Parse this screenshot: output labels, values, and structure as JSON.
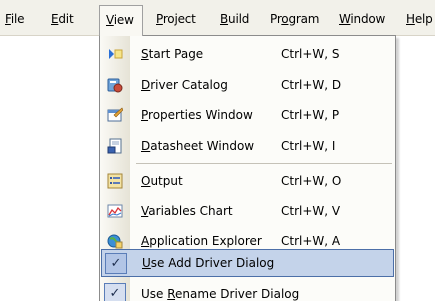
{
  "menubar": {
    "items": [
      {
        "label": "File",
        "mnemonic": "F",
        "rest": "ile"
      },
      {
        "label": "Edit",
        "mnemonic": "E",
        "rest": "dit"
      },
      {
        "label": "View",
        "mnemonic": "V",
        "rest": "iew"
      },
      {
        "label": "Project",
        "mnemonic": "P",
        "rest": "roject"
      },
      {
        "label": "Build",
        "mnemonic": "B",
        "rest": "uild"
      },
      {
        "label": "Program",
        "pre": "Pr",
        "mnemonic": "o",
        "rest": "gram"
      },
      {
        "label": "Window",
        "mnemonic": "W",
        "rest": "indow"
      },
      {
        "label": "Help",
        "pre": "",
        "mnemonic": "H",
        "rest": "elp"
      }
    ]
  },
  "view_menu": {
    "items": [
      {
        "pre": "",
        "mnemonic": "S",
        "rest": "tart Page",
        "shortcut": "Ctrl+W, S",
        "icon": "start-page-icon"
      },
      {
        "pre": "",
        "mnemonic": "D",
        "rest": "river Catalog",
        "shortcut": "Ctrl+W, D",
        "icon": "driver-catalog-icon"
      },
      {
        "pre": "",
        "mnemonic": "P",
        "rest": "roperties Window",
        "shortcut": "Ctrl+W, P",
        "icon": "properties-window-icon"
      },
      {
        "pre": "",
        "mnemonic": "D",
        "rest": "atasheet Window",
        "shortcut": "Ctrl+W, I",
        "icon": "datasheet-window-icon"
      },
      {
        "pre": "",
        "mnemonic": "O",
        "rest": "utput",
        "shortcut": "Ctrl+W, O",
        "icon": "output-icon"
      },
      {
        "pre": "",
        "mnemonic": "V",
        "rest": "ariables Chart",
        "shortcut": "Ctrl+W, V",
        "icon": "variables-chart-icon"
      },
      {
        "pre": "",
        "mnemonic": "A",
        "rest": "pplication Explorer",
        "shortcut": "Ctrl+W, A",
        "icon": "application-explorer-icon"
      },
      {
        "pre": "",
        "mnemonic": "U",
        "rest": "se Add Driver Dialog",
        "shortcut": "",
        "icon": "check-icon",
        "checked": true,
        "highlighted": true
      },
      {
        "pre": "Use ",
        "mnemonic": "R",
        "rest": "ename Driver Dialog",
        "shortcut": "",
        "icon": "check-icon",
        "checked": true
      }
    ],
    "check_glyph": "✓"
  },
  "colors": {
    "menubar_bg": "#f2f1ea",
    "highlight_bg": "#c4d3ea",
    "highlight_border": "#4c6fa8"
  }
}
